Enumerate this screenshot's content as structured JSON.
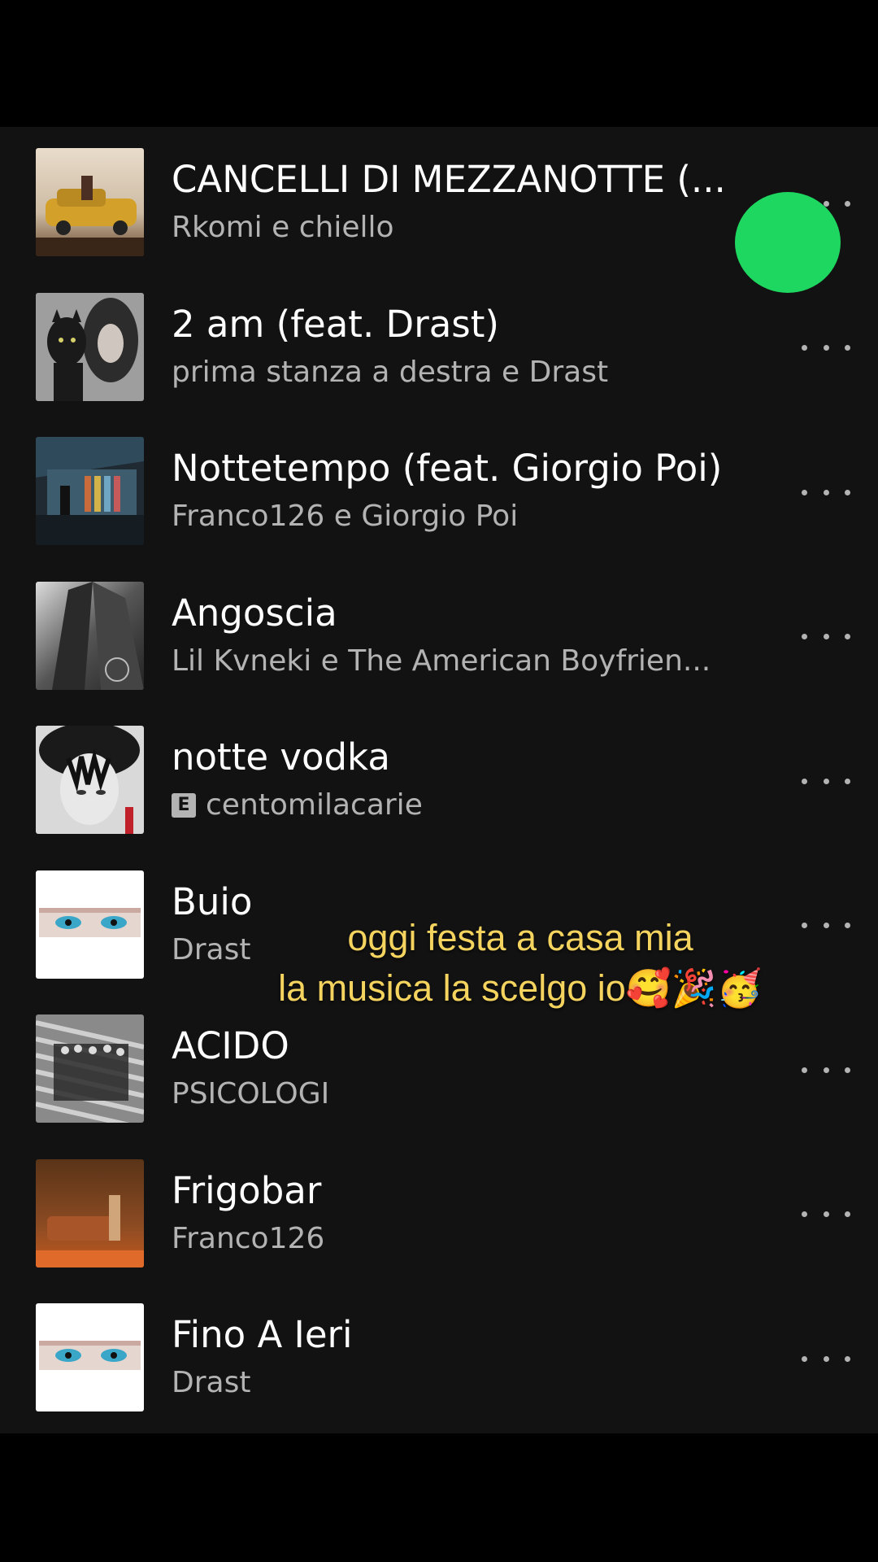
{
  "accent_color": "#1ed760",
  "background_color": "#121212",
  "tracks": [
    {
      "title": "CANCELLI DI MEZZANOTTE (...",
      "artist": "Rkomi e chiello",
      "explicit": false
    },
    {
      "title": "2 am (feat. Drast)",
      "artist": "prima stanza a destra e Drast",
      "explicit": false
    },
    {
      "title": "Nottetempo (feat. Giorgio Poi)",
      "artist": "Franco126 e Giorgio Poi",
      "explicit": false
    },
    {
      "title": "Angoscia",
      "artist": "Lil Kvneki e The American Boyfrien...",
      "explicit": false
    },
    {
      "title": "notte vodka",
      "artist": "centomilacarie",
      "explicit": true,
      "explicit_label": "E"
    },
    {
      "title": "Buio",
      "artist": "Drast",
      "explicit": false
    },
    {
      "title": "ACIDO",
      "artist": "PSICOLOGI",
      "explicit": false
    },
    {
      "title": "Frigobar",
      "artist": "Franco126",
      "explicit": false
    },
    {
      "title": "Fino A Ieri",
      "artist": "Drast",
      "explicit": false
    }
  ],
  "overlay": {
    "line1": "oggi festa a casa mia",
    "line2": "la musica la scelgo io🥰🎉🥳"
  },
  "icons": {
    "more": "more-options-icon",
    "play": "play-button-icon"
  }
}
